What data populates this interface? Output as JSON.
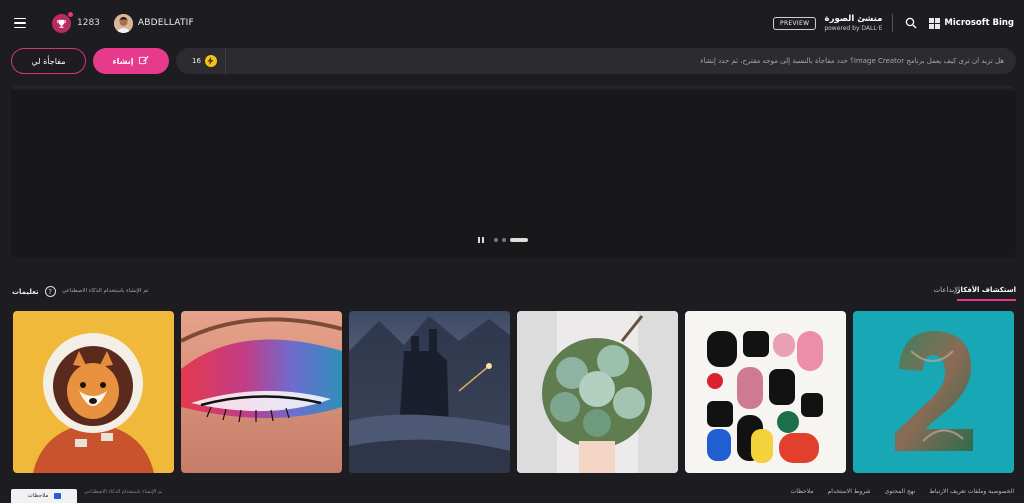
{
  "header": {
    "reward_count": "1283",
    "username": "ABDELLATIF",
    "preview_label": "PREVIEW",
    "app_title": "منشئ الصورة",
    "powered_by": "powered by DALL·E",
    "brand": "Microsoft Bing"
  },
  "actions": {
    "surprise_label": "مفاجأة لي",
    "create_label": "إنشاء"
  },
  "prompt": {
    "boost_count": "16",
    "placeholder": "هل تريد أن ترى كيف يعمل برنامج Image Creator؟ حدد مفاجأة بالنسبة إلى موجه مقترح، ثم حدد إنشاء"
  },
  "section": {
    "help_label": "تعليمات",
    "ai_note": "تم الإنشاء باستخدام الذكاء الاصطناعي",
    "tab_explore": "استكشاف الأفكار",
    "tab_creations": "الإبداعات"
  },
  "footer": {
    "links": [
      "الخصوصية وملفات تعريف الارتباط",
      "نهج المحتوى",
      "شروط الاستخدام",
      "ملاحظات"
    ],
    "feedback_label": "ملاحظات",
    "ai_note": "تم الإنشاء باستخدام الذكاء الاصطناعي"
  },
  "colors": {
    "accent": "#e83a8c",
    "background": "#1d1c20",
    "boost": "#f3c319"
  },
  "icons": [
    "hamburger-icon",
    "trophy-icon",
    "search-icon",
    "microsoft-logo-icon",
    "create-icon",
    "bolt-icon",
    "pause-icon",
    "help-icon",
    "feedback-icon"
  ],
  "gallery": [
    {
      "name": "gallery-tile-astronaut-dog"
    },
    {
      "name": "gallery-tile-eye-makeup"
    },
    {
      "name": "gallery-tile-dark-castle"
    },
    {
      "name": "gallery-tile-succulent-bouquet"
    },
    {
      "name": "gallery-tile-abstract-shapes"
    },
    {
      "name": "gallery-tile-number-two"
    }
  ]
}
